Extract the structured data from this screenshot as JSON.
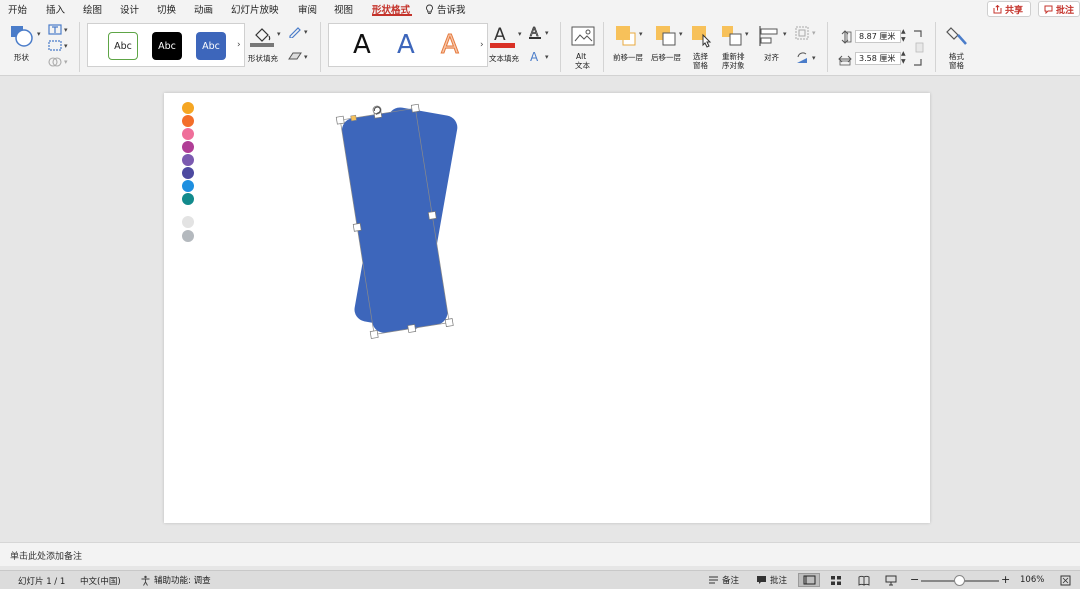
{
  "tabs": [
    {
      "label": "开始",
      "active": false
    },
    {
      "label": "插入",
      "active": false
    },
    {
      "label": "绘图",
      "active": false
    },
    {
      "label": "设计",
      "active": false
    },
    {
      "label": "切换",
      "active": false
    },
    {
      "label": "动画",
      "active": false
    },
    {
      "label": "幻灯片放映",
      "active": false
    },
    {
      "label": "审阅",
      "active": false
    },
    {
      "label": "视图",
      "active": false
    },
    {
      "label": "形状格式",
      "active": true
    }
  ],
  "tell_me": "告诉我",
  "share_label": "共享",
  "comments_label": "批注",
  "ribbon": {
    "shape_label": "形状",
    "style_gallery": [
      "Abc",
      "Abc",
      "Abc"
    ],
    "shape_fill_label": "形状填充",
    "wordart_gallery": [
      "A",
      "A",
      "A"
    ],
    "text_fill_label": "文本填充",
    "alt_text_label": [
      "Alt",
      "文本"
    ],
    "bring_forward_label": "前移一层",
    "send_backward_label": "后移一层",
    "selection_pane_label": [
      "选择",
      "窗格"
    ],
    "reorder_label": [
      "重新排",
      "序对象"
    ],
    "align_label": "对齐",
    "height_value": "8.87 厘米",
    "width_value": "3.58 厘米",
    "format_pane_label": [
      "格式",
      "窗格"
    ]
  },
  "colors": {
    "accent": "#c4332b",
    "shape_fill": "#3d66bb",
    "palette": [
      "#f5a623",
      "#f36e2a",
      "#ef6f9a",
      "#b03e96",
      "#7b5ab0",
      "#4d4aa0",
      "#1e8fe0",
      "#128a8c",
      "#e3e3e3",
      "#b4b9be"
    ]
  },
  "notes_placeholder": "单击此处添加备注",
  "status": {
    "slide_counter": "幻灯片 1 / 1",
    "language": "中文(中国)",
    "accessibility": "辅助功能: 调查",
    "notes_label": "备注",
    "comments_label": "批注",
    "zoom": "106%"
  }
}
